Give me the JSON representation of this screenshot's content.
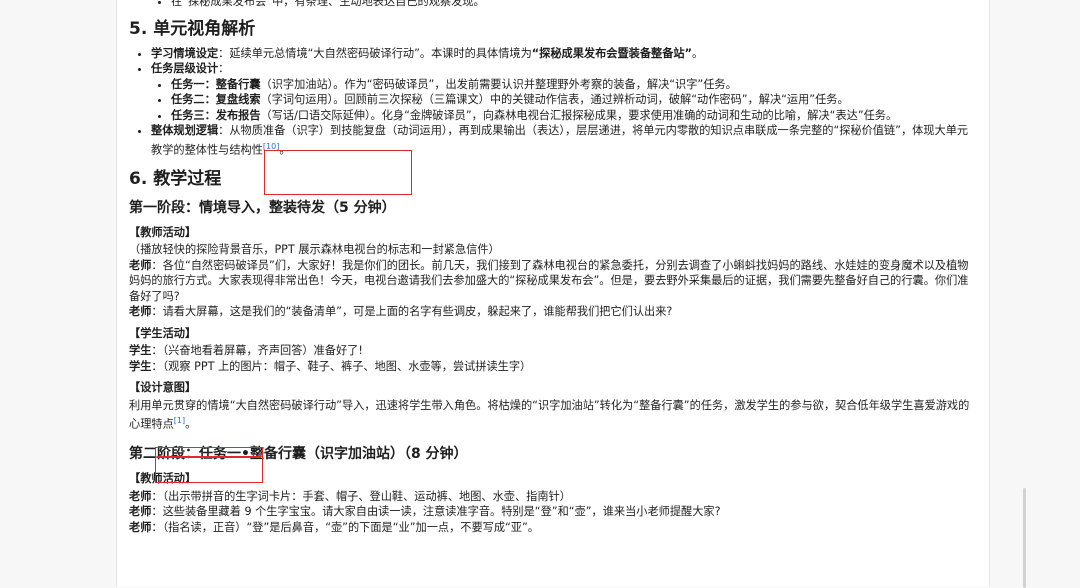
{
  "top_bullet": "在“探秘成果发布会”中，有条理、生动地表达自己的观察发现。",
  "section5": {
    "title": "5. 单元视角解析",
    "items": [
      {
        "label": "学习情境设定",
        "text": "：延续单元总情境“大自然密码破译行动”。本课时的具体情境为",
        "bold_tail": "“探秘成果发布会暨装备整备站”",
        "end": "。"
      },
      {
        "label": "任务层级设计",
        "text": "："
      }
    ],
    "subtasks": [
      {
        "label": "任务一：整备行囊",
        "text": "（识字加油站）。作为“密码破译员”，出发前需要认识并整理野外考察的装备，解决“识字”任务。"
      },
      {
        "label": "任务二：复盘线索",
        "text": "（字词句运用）。回顾前三次探秘（三篇课文）中的关键动作信表，通过辨析动词，破解“动作密码”，解决“运用”任务。"
      },
      {
        "label": "任务三：发布报告",
        "text": "（写话/口语交际延伸）。化身“金牌破译员”，向森林电视台汇报探秘成果，要求使用准确的动词和生动的比喻，解决“表达”任务。"
      }
    ],
    "logic": {
      "label": "整体规划逻辑",
      "text": "：从物质准备（识字）到技能复盘（动词运用），再到成果输出（表达），层层递进，将单元内零散的知识点串联成一条完整的“探秘价值链”，体现大单元教学的整体性与结构性",
      "ref": "[10]",
      "end": "。"
    }
  },
  "section6": {
    "title": "6. 教学过程"
  },
  "stage1": {
    "title": "第一阶段：情境导入，整装待发（5 分钟）",
    "teacher_head": "【教师活动】",
    "teacher_lines": [
      "（播放轻快的探险背景音乐，PPT 展示森林电视台的标志和一封紧急信件）",
      {
        "who": "老师",
        "text": "：各位“自然密码破译员”们，大家好！我是你们的团长。前几天，我们接到了森林电视台的紧急委托，分别去调查了小蝌蚪找妈妈的路线、水娃娃的变身魔术以及植物妈妈的旅行方式。大家表现得非常出色！今天，电视台邀请我们去参加盛大的“探秘成果发布会”。但是，要去野外采集最后的证据，我们需要先整备好自己的行囊。你们准备好了吗?"
      },
      {
        "who": "老师",
        "text": "：请看大屏幕，这是我们的“装备清单”，可是上面的名字有些调皮，躲起来了，谁能帮我们把它们认出来?"
      }
    ],
    "student_head": "【学生活动】",
    "student_lines": [
      {
        "who": "学生",
        "text": "：（兴奋地看着屏幕，齐声回答）准备好了!"
      },
      {
        "who": "学生",
        "text": "：（观察 PPT 上的图片：帽子、鞋子、裤子、地图、水壶等，尝试拼读生字）"
      }
    ],
    "design_head": "【设计意图】",
    "design_text": "利用单元贯穿的情境“大自然密码破译行动”导入，迅速将学生带入角色。将枯燥的“识字加油站”转化为“整备行囊”的任务，激发学生的参与欲，契合低年级学生喜爱游戏的心理特点",
    "design_ref": "[1]",
    "design_end": "。"
  },
  "stage2": {
    "title": "第二阶段：任务一•整备行囊（识字加油站）（8 分钟）",
    "teacher_head": "【教师活动】",
    "lines": [
      {
        "who": "老师",
        "text": "：（出示带拼音的生字词卡片：手套、帽子、登山鞋、运动裤、地图、水壶、指南针）"
      },
      {
        "who": "老师",
        "text": "：这些装备里藏着 9 个生字宝宝。请大家自由读一读，注意读准字音。特别是“登”和“壶”，谁来当小老师提醒大家?"
      },
      {
        "who": "老师",
        "text": "：（指名读，正音）“登”是后鼻音，“壶”的下面是“业”加一点，不要写成“亚”。"
      }
    ]
  },
  "annotation_color": "#e02a2a",
  "link_color": "#2f6fd6"
}
